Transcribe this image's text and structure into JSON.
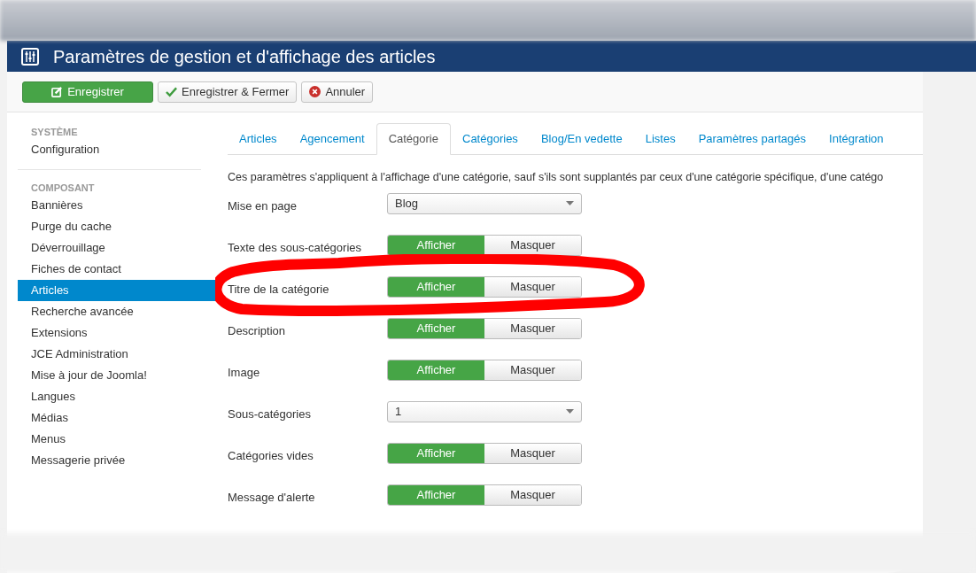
{
  "header": {
    "title": "Paramètres de gestion et d'affichage des articles"
  },
  "toolbar": [
    {
      "kind": "save",
      "label": "Enregistrer"
    },
    {
      "kind": "save_close",
      "label": "Enregistrer & Fermer"
    },
    {
      "kind": "cancel",
      "label": "Annuler"
    }
  ],
  "sidebar": {
    "sections": [
      {
        "heading": "SYSTÈME",
        "items": [
          {
            "label": "Configuration",
            "selected": false
          }
        ]
      },
      {
        "heading": "COMPOSANT",
        "items": [
          {
            "label": "Bannières",
            "selected": false
          },
          {
            "label": "Purge du cache",
            "selected": false
          },
          {
            "label": "Déverrouillage",
            "selected": false
          },
          {
            "label": "Fiches de contact",
            "selected": false
          },
          {
            "label": "Articles",
            "selected": true
          },
          {
            "label": "Recherche avancée",
            "selected": false
          },
          {
            "label": "Extensions",
            "selected": false
          },
          {
            "label": "JCE Administration",
            "selected": false
          },
          {
            "label": "Mise à jour de Joomla!",
            "selected": false
          },
          {
            "label": "Langues",
            "selected": false
          },
          {
            "label": "Médias",
            "selected": false
          },
          {
            "label": "Menus",
            "selected": false
          },
          {
            "label": "Messagerie privée",
            "selected": false
          }
        ]
      }
    ]
  },
  "tabs": [
    {
      "label": "Articles",
      "selected": false
    },
    {
      "label": "Agencement",
      "selected": false
    },
    {
      "label": "Catégorie",
      "selected": true
    },
    {
      "label": "Catégories",
      "selected": false
    },
    {
      "label": "Blog/En vedette",
      "selected": false
    },
    {
      "label": "Listes",
      "selected": false
    },
    {
      "label": "Paramètres partagés",
      "selected": false
    },
    {
      "label": "Intégration",
      "selected": false
    }
  ],
  "description": "Ces paramètres s'appliquent à l'affichage d'une catégorie, sauf s'ils sont supplantés par ceux d'une catégorie spécifique, d'une catégo",
  "fields": [
    {
      "kind": "select",
      "label": "Mise en page",
      "value": "Blog"
    },
    {
      "kind": "toggle",
      "label": "Texte des sous-catégories",
      "options": [
        {
          "label": "Afficher",
          "selected": true
        },
        {
          "label": "Masquer",
          "selected": false
        }
      ]
    },
    {
      "kind": "toggle",
      "label": "Titre de la catégorie",
      "highlighted": true,
      "options": [
        {
          "label": "Afficher",
          "selected": true
        },
        {
          "label": "Masquer",
          "selected": false
        }
      ]
    },
    {
      "kind": "toggle",
      "label": "Description",
      "options": [
        {
          "label": "Afficher",
          "selected": true
        },
        {
          "label": "Masquer",
          "selected": false
        }
      ]
    },
    {
      "kind": "toggle",
      "label": "Image",
      "options": [
        {
          "label": "Afficher",
          "selected": true
        },
        {
          "label": "Masquer",
          "selected": false
        }
      ]
    },
    {
      "kind": "select",
      "label": "Sous-catégories",
      "value": "1"
    },
    {
      "kind": "toggle",
      "label": "Catégories vides",
      "options": [
        {
          "label": "Afficher",
          "selected": true
        },
        {
          "label": "Masquer",
          "selected": false
        }
      ]
    },
    {
      "kind": "toggle",
      "label": "Message d'alerte",
      "options": [
        {
          "label": "Afficher",
          "selected": true
        },
        {
          "label": "Masquer",
          "selected": false
        }
      ]
    }
  ]
}
